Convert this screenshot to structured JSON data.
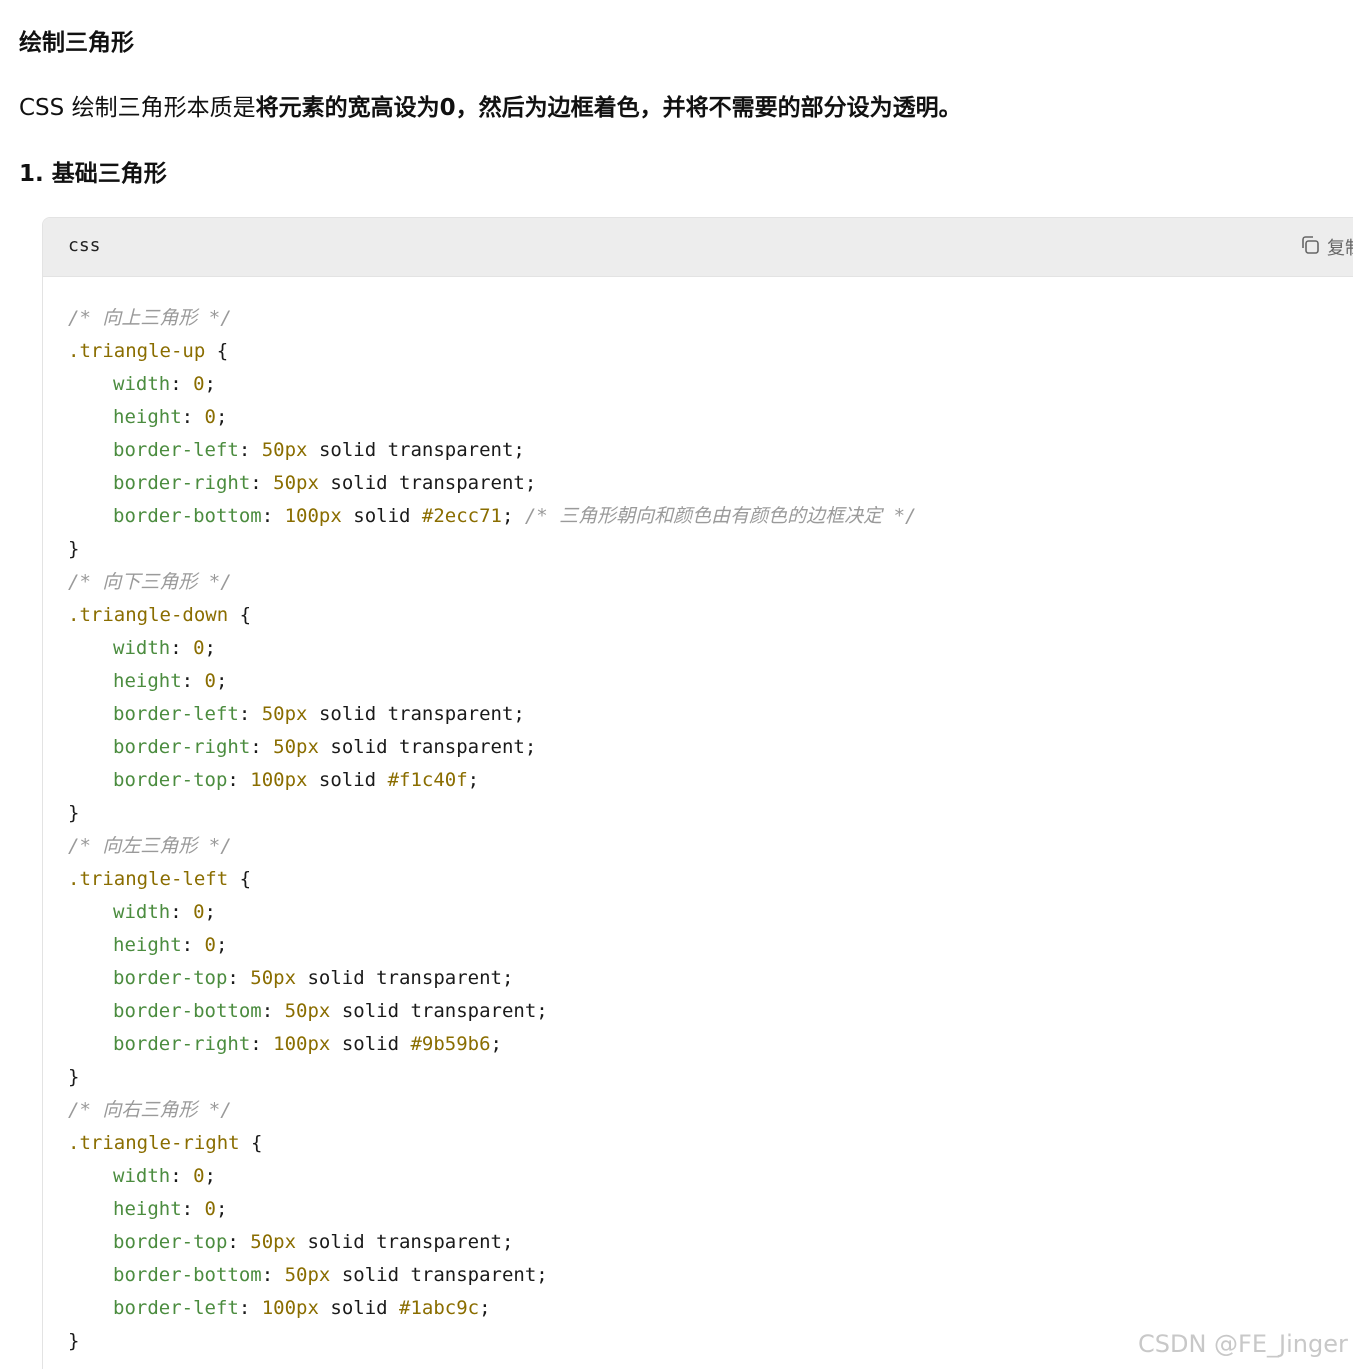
{
  "heading_main": "绘制三角形",
  "intro": {
    "prefix": "CSS 绘制三角形本质是",
    "bold": "将元素的宽高设为0，然后为边框着色，并将不需要的部分设为透明。"
  },
  "heading_sub": "1. 基础三角形",
  "code_block": {
    "language": "css",
    "copy_label": "复制",
    "lines": [
      {
        "indent": false,
        "tokens": [
          {
            "t": "comment",
            "v": "/* 向上三角形 */"
          }
        ]
      },
      {
        "indent": false,
        "tokens": [
          {
            "t": "selector",
            "v": ".triangle-up"
          },
          {
            "t": "punct",
            "v": " {"
          }
        ]
      },
      {
        "indent": true,
        "tokens": [
          {
            "t": "prop",
            "v": "width"
          },
          {
            "t": "punct",
            "v": ": "
          },
          {
            "t": "num",
            "v": "0"
          },
          {
            "t": "punct",
            "v": ";"
          }
        ]
      },
      {
        "indent": true,
        "tokens": [
          {
            "t": "prop",
            "v": "height"
          },
          {
            "t": "punct",
            "v": ": "
          },
          {
            "t": "num",
            "v": "0"
          },
          {
            "t": "punct",
            "v": ";"
          }
        ]
      },
      {
        "indent": true,
        "tokens": [
          {
            "t": "prop",
            "v": "border-left"
          },
          {
            "t": "punct",
            "v": ": "
          },
          {
            "t": "num",
            "v": "50px"
          },
          {
            "t": "val",
            "v": " solid transparent;"
          }
        ]
      },
      {
        "indent": true,
        "tokens": [
          {
            "t": "prop",
            "v": "border-right"
          },
          {
            "t": "punct",
            "v": ": "
          },
          {
            "t": "num",
            "v": "50px"
          },
          {
            "t": "val",
            "v": " solid transparent;"
          }
        ]
      },
      {
        "indent": true,
        "tokens": [
          {
            "t": "prop",
            "v": "border-bottom"
          },
          {
            "t": "punct",
            "v": ": "
          },
          {
            "t": "num",
            "v": "100px"
          },
          {
            "t": "val",
            "v": " solid "
          },
          {
            "t": "num",
            "v": "#2ecc71"
          },
          {
            "t": "punct",
            "v": "; "
          },
          {
            "t": "comment",
            "v": "/* 三角形朝向和颜色由有颜色的边框决定 */"
          }
        ]
      },
      {
        "indent": false,
        "tokens": [
          {
            "t": "punct",
            "v": "}"
          }
        ]
      },
      {
        "indent": false,
        "tokens": [
          {
            "t": "comment",
            "v": "/* 向下三角形 */"
          }
        ]
      },
      {
        "indent": false,
        "tokens": [
          {
            "t": "selector",
            "v": ".triangle-down"
          },
          {
            "t": "punct",
            "v": " {"
          }
        ]
      },
      {
        "indent": true,
        "tokens": [
          {
            "t": "prop",
            "v": "width"
          },
          {
            "t": "punct",
            "v": ": "
          },
          {
            "t": "num",
            "v": "0"
          },
          {
            "t": "punct",
            "v": ";"
          }
        ]
      },
      {
        "indent": true,
        "tokens": [
          {
            "t": "prop",
            "v": "height"
          },
          {
            "t": "punct",
            "v": ": "
          },
          {
            "t": "num",
            "v": "0"
          },
          {
            "t": "punct",
            "v": ";"
          }
        ]
      },
      {
        "indent": true,
        "tokens": [
          {
            "t": "prop",
            "v": "border-left"
          },
          {
            "t": "punct",
            "v": ": "
          },
          {
            "t": "num",
            "v": "50px"
          },
          {
            "t": "val",
            "v": " solid transparent;"
          }
        ]
      },
      {
        "indent": true,
        "tokens": [
          {
            "t": "prop",
            "v": "border-right"
          },
          {
            "t": "punct",
            "v": ": "
          },
          {
            "t": "num",
            "v": "50px"
          },
          {
            "t": "val",
            "v": " solid transparent;"
          }
        ]
      },
      {
        "indent": true,
        "tokens": [
          {
            "t": "prop",
            "v": "border-top"
          },
          {
            "t": "punct",
            "v": ": "
          },
          {
            "t": "num",
            "v": "100px"
          },
          {
            "t": "val",
            "v": " solid "
          },
          {
            "t": "num",
            "v": "#f1c40f"
          },
          {
            "t": "punct",
            "v": ";"
          }
        ]
      },
      {
        "indent": false,
        "tokens": [
          {
            "t": "punct",
            "v": "}"
          }
        ]
      },
      {
        "indent": false,
        "tokens": [
          {
            "t": "comment",
            "v": "/* 向左三角形 */"
          }
        ]
      },
      {
        "indent": false,
        "tokens": [
          {
            "t": "selector",
            "v": ".triangle-left"
          },
          {
            "t": "punct",
            "v": " {"
          }
        ]
      },
      {
        "indent": true,
        "tokens": [
          {
            "t": "prop",
            "v": "width"
          },
          {
            "t": "punct",
            "v": ": "
          },
          {
            "t": "num",
            "v": "0"
          },
          {
            "t": "punct",
            "v": ";"
          }
        ]
      },
      {
        "indent": true,
        "tokens": [
          {
            "t": "prop",
            "v": "height"
          },
          {
            "t": "punct",
            "v": ": "
          },
          {
            "t": "num",
            "v": "0"
          },
          {
            "t": "punct",
            "v": ";"
          }
        ]
      },
      {
        "indent": true,
        "tokens": [
          {
            "t": "prop",
            "v": "border-top"
          },
          {
            "t": "punct",
            "v": ": "
          },
          {
            "t": "num",
            "v": "50px"
          },
          {
            "t": "val",
            "v": " solid transparent;"
          }
        ]
      },
      {
        "indent": true,
        "tokens": [
          {
            "t": "prop",
            "v": "border-bottom"
          },
          {
            "t": "punct",
            "v": ": "
          },
          {
            "t": "num",
            "v": "50px"
          },
          {
            "t": "val",
            "v": " solid transparent;"
          }
        ]
      },
      {
        "indent": true,
        "tokens": [
          {
            "t": "prop",
            "v": "border-right"
          },
          {
            "t": "punct",
            "v": ": "
          },
          {
            "t": "num",
            "v": "100px"
          },
          {
            "t": "val",
            "v": " solid "
          },
          {
            "t": "num",
            "v": "#9b59b6"
          },
          {
            "t": "punct",
            "v": ";"
          }
        ]
      },
      {
        "indent": false,
        "tokens": [
          {
            "t": "punct",
            "v": "}"
          }
        ]
      },
      {
        "indent": false,
        "tokens": [
          {
            "t": "comment",
            "v": "/* 向右三角形 */"
          }
        ]
      },
      {
        "indent": false,
        "tokens": [
          {
            "t": "selector",
            "v": ".triangle-right"
          },
          {
            "t": "punct",
            "v": " {"
          }
        ]
      },
      {
        "indent": true,
        "tokens": [
          {
            "t": "prop",
            "v": "width"
          },
          {
            "t": "punct",
            "v": ": "
          },
          {
            "t": "num",
            "v": "0"
          },
          {
            "t": "punct",
            "v": ";"
          }
        ]
      },
      {
        "indent": true,
        "tokens": [
          {
            "t": "prop",
            "v": "height"
          },
          {
            "t": "punct",
            "v": ": "
          },
          {
            "t": "num",
            "v": "0"
          },
          {
            "t": "punct",
            "v": ";"
          }
        ]
      },
      {
        "indent": true,
        "tokens": [
          {
            "t": "prop",
            "v": "border-top"
          },
          {
            "t": "punct",
            "v": ": "
          },
          {
            "t": "num",
            "v": "50px"
          },
          {
            "t": "val",
            "v": " solid transparent;"
          }
        ]
      },
      {
        "indent": true,
        "tokens": [
          {
            "t": "prop",
            "v": "border-bottom"
          },
          {
            "t": "punct",
            "v": ": "
          },
          {
            "t": "num",
            "v": "50px"
          },
          {
            "t": "val",
            "v": " solid transparent;"
          }
        ]
      },
      {
        "indent": true,
        "tokens": [
          {
            "t": "prop",
            "v": "border-left"
          },
          {
            "t": "punct",
            "v": ": "
          },
          {
            "t": "num",
            "v": "100px"
          },
          {
            "t": "val",
            "v": " solid "
          },
          {
            "t": "num",
            "v": "#1abc9c"
          },
          {
            "t": "punct",
            "v": ";"
          }
        ]
      },
      {
        "indent": false,
        "tokens": [
          {
            "t": "punct",
            "v": "}"
          }
        ]
      }
    ]
  },
  "watermark": "CSDN @FE_Jinger",
  "icons": {
    "copy": "copy-icon"
  }
}
